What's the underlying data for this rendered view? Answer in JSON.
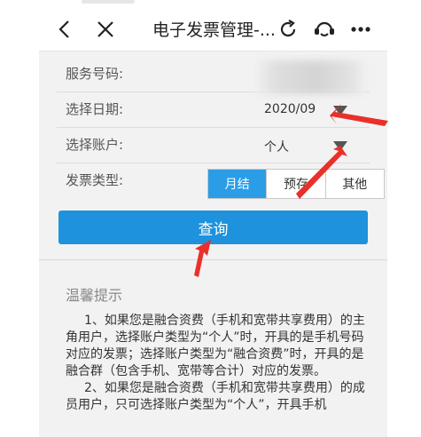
{
  "navbar": {
    "title": "电子发票管理-...",
    "icons": [
      "back-arrow-icon",
      "close-icon",
      "refresh-icon",
      "customer-service-icon",
      "more-icon"
    ]
  },
  "form": {
    "service_number_label": "服务号码:",
    "date_label": "选择日期:",
    "date_value": "2020/09",
    "account_label": "选择账户:",
    "account_value": "个人",
    "invoice_type_label": "发票类型:",
    "invoice_types": [
      "月结",
      "预存",
      "其他"
    ],
    "invoice_type_selected": "月结"
  },
  "query_button": "查询",
  "tips": {
    "title": "温馨提示",
    "paragraphs": [
      "1、如果您是融合资费（手机和宽带共享费用）的主角用户，选择账户类型为“个人”时，开具的是手机号码对应的发票；选择账户类型为“融合资费”时，开具的是融合群（包含手机、宽带等合计）对应的发票。",
      "2、如果您是融合资费（手机和宽带共享费用）的成员用户，只可选择账户类型为“个人”，开具手机"
    ]
  },
  "colors": {
    "accent": "#1e92dc",
    "segment_active": "#2a9de6",
    "annotation_arrow": "#e8312a"
  }
}
